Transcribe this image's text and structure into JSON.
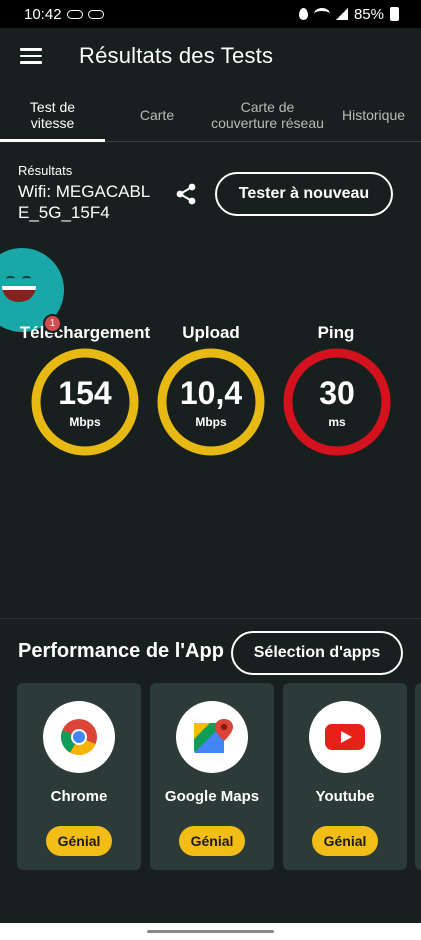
{
  "status_bar": {
    "time": "10:42",
    "battery": "85%"
  },
  "app_bar": {
    "title": "Résultats des Tests",
    "menu_icon": "hamburger-menu-icon"
  },
  "tabs": [
    {
      "label": "Test de\nvitesse",
      "active": true
    },
    {
      "label": "Carte",
      "active": false
    },
    {
      "label": "Carte de\ncouverture réseau",
      "active": false
    },
    {
      "label": "Historique",
      "active": false
    }
  ],
  "results": {
    "label": "Résultats",
    "network": "Wifi: MEGACABLE_5G_15F4",
    "retest_label": "Tester à nouveau",
    "share_icon": "share-icon"
  },
  "mascot": {
    "badge_count": "1"
  },
  "gauges": [
    {
      "label": "Téléchargement",
      "value": "154",
      "unit": "Mbps",
      "color": "#e8b913",
      "fill": 1.0
    },
    {
      "label": "Upload",
      "value": "10,4",
      "unit": "Mbps",
      "color": "#e8b913",
      "fill": 1.0
    },
    {
      "label": "Ping",
      "value": "30",
      "unit": "ms",
      "color": "#d3121e",
      "fill": 1.0
    }
  ],
  "performance": {
    "title": "Performance de l'App",
    "select_label": "Sélection d'apps",
    "apps": [
      {
        "name": "Chrome",
        "rating": "Génial",
        "icon": "chrome-icon"
      },
      {
        "name": "Google Maps",
        "rating": "Génial",
        "icon": "google-maps-icon"
      },
      {
        "name": "Youtube",
        "rating": "Génial",
        "icon": "youtube-icon"
      }
    ]
  },
  "colors": {
    "background": "#17201f",
    "card": "#2c3a38",
    "accent_yellow": "#e8b913",
    "accent_red": "#d3121e"
  }
}
